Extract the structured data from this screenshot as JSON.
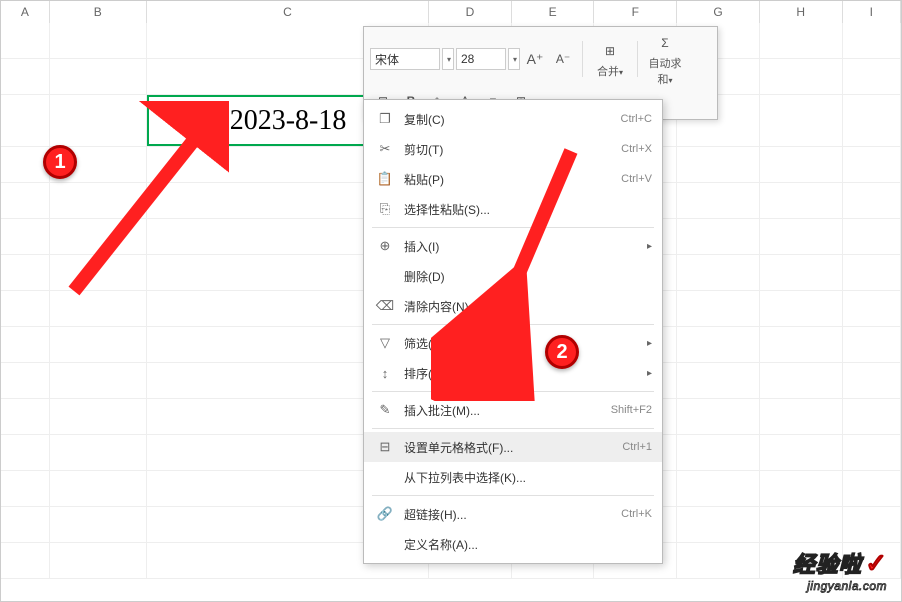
{
  "columns": [
    "A",
    "B",
    "C",
    "D",
    "E",
    "F",
    "G",
    "H",
    "I"
  ],
  "selected_cell_value": "2023-8-18",
  "mini_toolbar": {
    "font_name": "宋体",
    "font_size": "28",
    "merge_label": "合并",
    "autosum_label": "自动求和"
  },
  "context_menu": {
    "copy": "复制(C)",
    "copy_sc": "Ctrl+C",
    "cut": "剪切(T)",
    "cut_sc": "Ctrl+X",
    "paste": "粘贴(P)",
    "paste_sc": "Ctrl+V",
    "paste_special": "选择性粘贴(S)...",
    "insert": "插入(I)",
    "delete": "删除(D)",
    "clear": "清除内容(N)",
    "filter": "筛选(L)",
    "sort": "排序(U)",
    "insert_comment": "插入批注(M)...",
    "insert_comment_sc": "Shift+F2",
    "format_cells": "设置单元格格式(F)...",
    "format_cells_sc": "Ctrl+1",
    "pick_from_list": "从下拉列表中选择(K)...",
    "hyperlink": "超链接(H)...",
    "hyperlink_sc": "Ctrl+K",
    "define_name": "定义名称(A)..."
  },
  "markers": {
    "m1": "1",
    "m2": "2"
  },
  "watermark": {
    "main": "经验啦",
    "sub": "jingyanla.com"
  }
}
